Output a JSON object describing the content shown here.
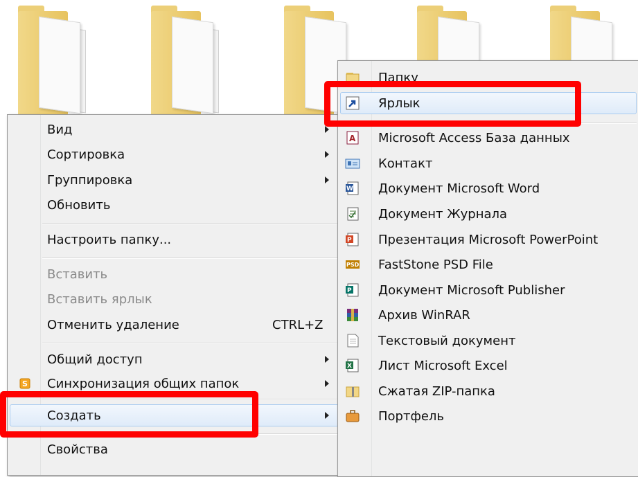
{
  "context_menu": {
    "items": [
      {
        "label": "Вид",
        "submenu": true
      },
      {
        "label": "Сортировка",
        "submenu": true
      },
      {
        "label": "Группировка",
        "submenu": true
      },
      {
        "label": "Обновить"
      },
      {
        "label": "Настроить папку..."
      },
      {
        "label": "Вставить",
        "disabled": true
      },
      {
        "label": "Вставить ярлык",
        "disabled": true
      },
      {
        "label": "Отменить удаление",
        "shortcut": "CTRL+Z"
      },
      {
        "label": "Общий доступ",
        "submenu": true
      },
      {
        "label": "Синхронизация общих папок",
        "submenu": true,
        "icon": "sync-s-icon"
      },
      {
        "label": "Создать",
        "submenu": true,
        "highlighted": true
      },
      {
        "label": "Свойства"
      }
    ]
  },
  "create_submenu": {
    "items": [
      {
        "label": "Папку",
        "icon": "folder-icon"
      },
      {
        "label": "Ярлык",
        "icon": "shortcut-icon",
        "highlighted": true
      },
      {
        "label": "Microsoft Access База данных",
        "icon": "access-icon"
      },
      {
        "label": "Контакт",
        "icon": "contact-icon"
      },
      {
        "label": "Документ Microsoft Word",
        "icon": "word-icon"
      },
      {
        "label": "Документ Журнала",
        "icon": "journal-icon"
      },
      {
        "label": "Презентация Microsoft PowerPoint",
        "icon": "powerpoint-icon"
      },
      {
        "label": "FastStone PSD File",
        "icon": "psd-icon"
      },
      {
        "label": "Документ Microsoft Publisher",
        "icon": "publisher-icon"
      },
      {
        "label": "Архив WinRAR",
        "icon": "winrar-icon"
      },
      {
        "label": "Текстовый документ",
        "icon": "text-document-icon"
      },
      {
        "label": "Лист Microsoft Excel",
        "icon": "excel-icon"
      },
      {
        "label": "Сжатая ZIP-папка",
        "icon": "zip-folder-icon"
      },
      {
        "label": "Портфель",
        "icon": "briefcase-icon"
      }
    ]
  },
  "colors": {
    "annotation": "#ff0000",
    "highlight_border": "#aaccf0"
  }
}
